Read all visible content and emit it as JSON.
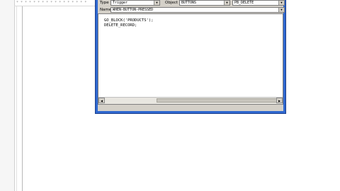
{
  "background": {
    "header_text": "* * * * * * * * * * * * * * * * *"
  },
  "editor_dialog": {
    "type_label": "Type",
    "type_value": "Trigger",
    "object_label": "Object",
    "object_value": "BUTTONS",
    "item_value": "PB_DELETE",
    "name_label": "Name",
    "name_value": "WHEN-BUTTON-PRESSED",
    "code_lines": [
      "GO_BLOCK('PRODUCTS');",
      "DELETE_RECORD;"
    ]
  },
  "colors": {
    "dialog_border": "#2f68d0",
    "panel": "#d4d0c8"
  }
}
